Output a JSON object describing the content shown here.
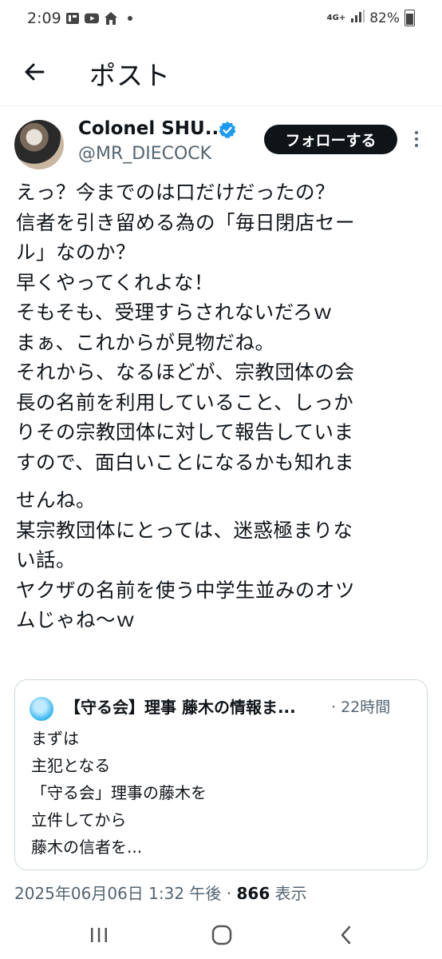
{
  "status_bar": {
    "time": "2:09",
    "network": "4G+",
    "battery": "82%"
  },
  "header": {
    "title": "ポスト"
  },
  "author": {
    "display_name": "Colonel SHU...",
    "handle": "@MR_DIECOCK",
    "follow_label": "フォローする"
  },
  "tweet": {
    "lines": [
      "えっ？今までのは口だけだったの？",
      "信者を引き留める為の「毎日閉店セー",
      "ル」なのか？",
      "早くやってくれよな！",
      "そもそも、受理すらされないだろｗ",
      "まぁ、これからが見物だね。",
      "それから、なるほどが、宗教団体の会",
      "長の名前を利用していること、しっか",
      "りその宗教団体に対して報告していま",
      "すので、面白いことになるかも知れま",
      "せんね。",
      "某宗教団体にとっては、迷惑極まりな",
      "い話。",
      "ヤクザの名前を使う中学生並みのオツ",
      "ムじゃね〜ｗ"
    ]
  },
  "quote": {
    "name": "【守る会】理事 藤木の情報ま...",
    "time": "· 22時間",
    "lines": [
      "まずは",
      "主犯となる",
      "「守る会」理事の藤木を",
      "立件してから",
      "藤木の信者を..."
    ]
  },
  "meta": {
    "datetime": "2025年06月06日 1:32 午後 · ",
    "views": "866",
    "views_label": " 表示"
  },
  "colors": {
    "text": "#0f1419",
    "secondary": "#536471",
    "verified": "#1d9bf0",
    "follow_bg": "#0f1419",
    "border": "#cfd9de"
  }
}
